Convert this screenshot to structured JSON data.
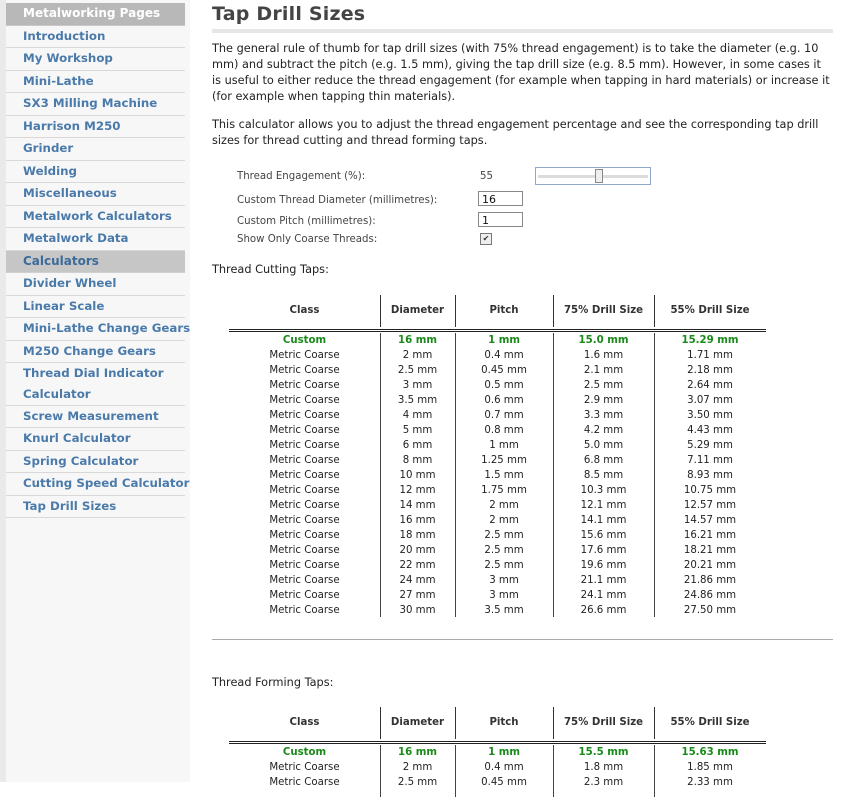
{
  "sidebar": {
    "items": [
      {
        "label": "Metalworking Pages",
        "kind": "head"
      },
      {
        "label": "Introduction"
      },
      {
        "label": "My Workshop"
      },
      {
        "label": "Mini-Lathe"
      },
      {
        "label": "SX3 Milling Machine"
      },
      {
        "label": "Harrison M250"
      },
      {
        "label": "Grinder"
      },
      {
        "label": "Welding"
      },
      {
        "label": "Miscellaneous"
      },
      {
        "label": "Metalwork Calculators"
      },
      {
        "label": "Metalwork Data"
      },
      {
        "label": "Calculators",
        "kind": "head2"
      },
      {
        "label": "Divider Wheel"
      },
      {
        "label": "Linear Scale"
      },
      {
        "label": "Mini-Lathe Change Gears"
      },
      {
        "label": "M250 Change Gears"
      },
      {
        "label": "Thread Dial Indicator Calculator",
        "kind": "tall"
      },
      {
        "label": "Screw Measurement"
      },
      {
        "label": "Knurl Calculator"
      },
      {
        "label": "Spring Calculator"
      },
      {
        "label": "Cutting Speed Calculator"
      },
      {
        "label": "Tap Drill Sizes"
      }
    ]
  },
  "page": {
    "title": "Tap Drill Sizes",
    "intro1": "The general rule of thumb for tap drill sizes (with 75% thread engagement) is to take the diameter (e.g. 10 mm) and subtract the pitch (e.g. 1.5 mm), giving the tap drill size (e.g. 8.5 mm). However, in some cases it is useful to either reduce the thread engagement (for example when tapping in hard materials) or increase it (for example when tapping thin materials).",
    "intro2": "This calculator allows you to adjust the thread engagement percentage and see the corresponding tap drill sizes for thread cutting and thread forming taps."
  },
  "form": {
    "engagement_label": "Thread Engagement (%):",
    "engagement_value": "55",
    "engagement_slider_level": 0.55,
    "diameter_label": "Custom Thread Diameter (millimetres):",
    "diameter_value": "16",
    "pitch_label": "Custom Pitch (millimetres):",
    "pitch_value": "1",
    "coarse_label": "Show Only Coarse Threads:",
    "coarse_checked": true
  },
  "chart_data": [
    {
      "type": "table",
      "title": "Thread Cutting Taps:",
      "columns": [
        "Class",
        "Diameter",
        "Pitch",
        "75% Drill Size",
        "55% Drill Size"
      ],
      "rows": [
        [
          "Custom",
          "16 mm",
          "1 mm",
          "15.0 mm",
          "15.29 mm"
        ],
        [
          "Metric Coarse",
          "2 mm",
          "0.4 mm",
          "1.6 mm",
          "1.71 mm"
        ],
        [
          "Metric Coarse",
          "2.5 mm",
          "0.45 mm",
          "2.1 mm",
          "2.18 mm"
        ],
        [
          "Metric Coarse",
          "3 mm",
          "0.5 mm",
          "2.5 mm",
          "2.64 mm"
        ],
        [
          "Metric Coarse",
          "3.5 mm",
          "0.6 mm",
          "2.9 mm",
          "3.07 mm"
        ],
        [
          "Metric Coarse",
          "4 mm",
          "0.7 mm",
          "3.3 mm",
          "3.50 mm"
        ],
        [
          "Metric Coarse",
          "5 mm",
          "0.8 mm",
          "4.2 mm",
          "4.43 mm"
        ],
        [
          "Metric Coarse",
          "6 mm",
          "1 mm",
          "5.0 mm",
          "5.29 mm"
        ],
        [
          "Metric Coarse",
          "8 mm",
          "1.25 mm",
          "6.8 mm",
          "7.11 mm"
        ],
        [
          "Metric Coarse",
          "10 mm",
          "1.5 mm",
          "8.5 mm",
          "8.93 mm"
        ],
        [
          "Metric Coarse",
          "12 mm",
          "1.75 mm",
          "10.3 mm",
          "10.75 mm"
        ],
        [
          "Metric Coarse",
          "14 mm",
          "2 mm",
          "12.1 mm",
          "12.57 mm"
        ],
        [
          "Metric Coarse",
          "16 mm",
          "2 mm",
          "14.1 mm",
          "14.57 mm"
        ],
        [
          "Metric Coarse",
          "18 mm",
          "2.5 mm",
          "15.6 mm",
          "16.21 mm"
        ],
        [
          "Metric Coarse",
          "20 mm",
          "2.5 mm",
          "17.6 mm",
          "18.21 mm"
        ],
        [
          "Metric Coarse",
          "22 mm",
          "2.5 mm",
          "19.6 mm",
          "20.21 mm"
        ],
        [
          "Metric Coarse",
          "24 mm",
          "3 mm",
          "21.1 mm",
          "21.86 mm"
        ],
        [
          "Metric Coarse",
          "27 mm",
          "3 mm",
          "24.1 mm",
          "24.86 mm"
        ],
        [
          "Metric Coarse",
          "30 mm",
          "3.5 mm",
          "26.6 mm",
          "27.50 mm"
        ]
      ]
    },
    {
      "type": "table",
      "title": "Thread Forming Taps:",
      "columns": [
        "Class",
        "Diameter",
        "Pitch",
        "75% Drill Size",
        "55% Drill Size"
      ],
      "rows": [
        [
          "Custom",
          "16 mm",
          "1 mm",
          "15.5 mm",
          "15.63 mm"
        ],
        [
          "Metric Coarse",
          "2 mm",
          "0.4 mm",
          "1.8 mm",
          "1.85 mm"
        ],
        [
          "Metric Coarse",
          "2.5 mm",
          "0.45 mm",
          "2.3 mm",
          "2.33 mm"
        ]
      ]
    }
  ]
}
